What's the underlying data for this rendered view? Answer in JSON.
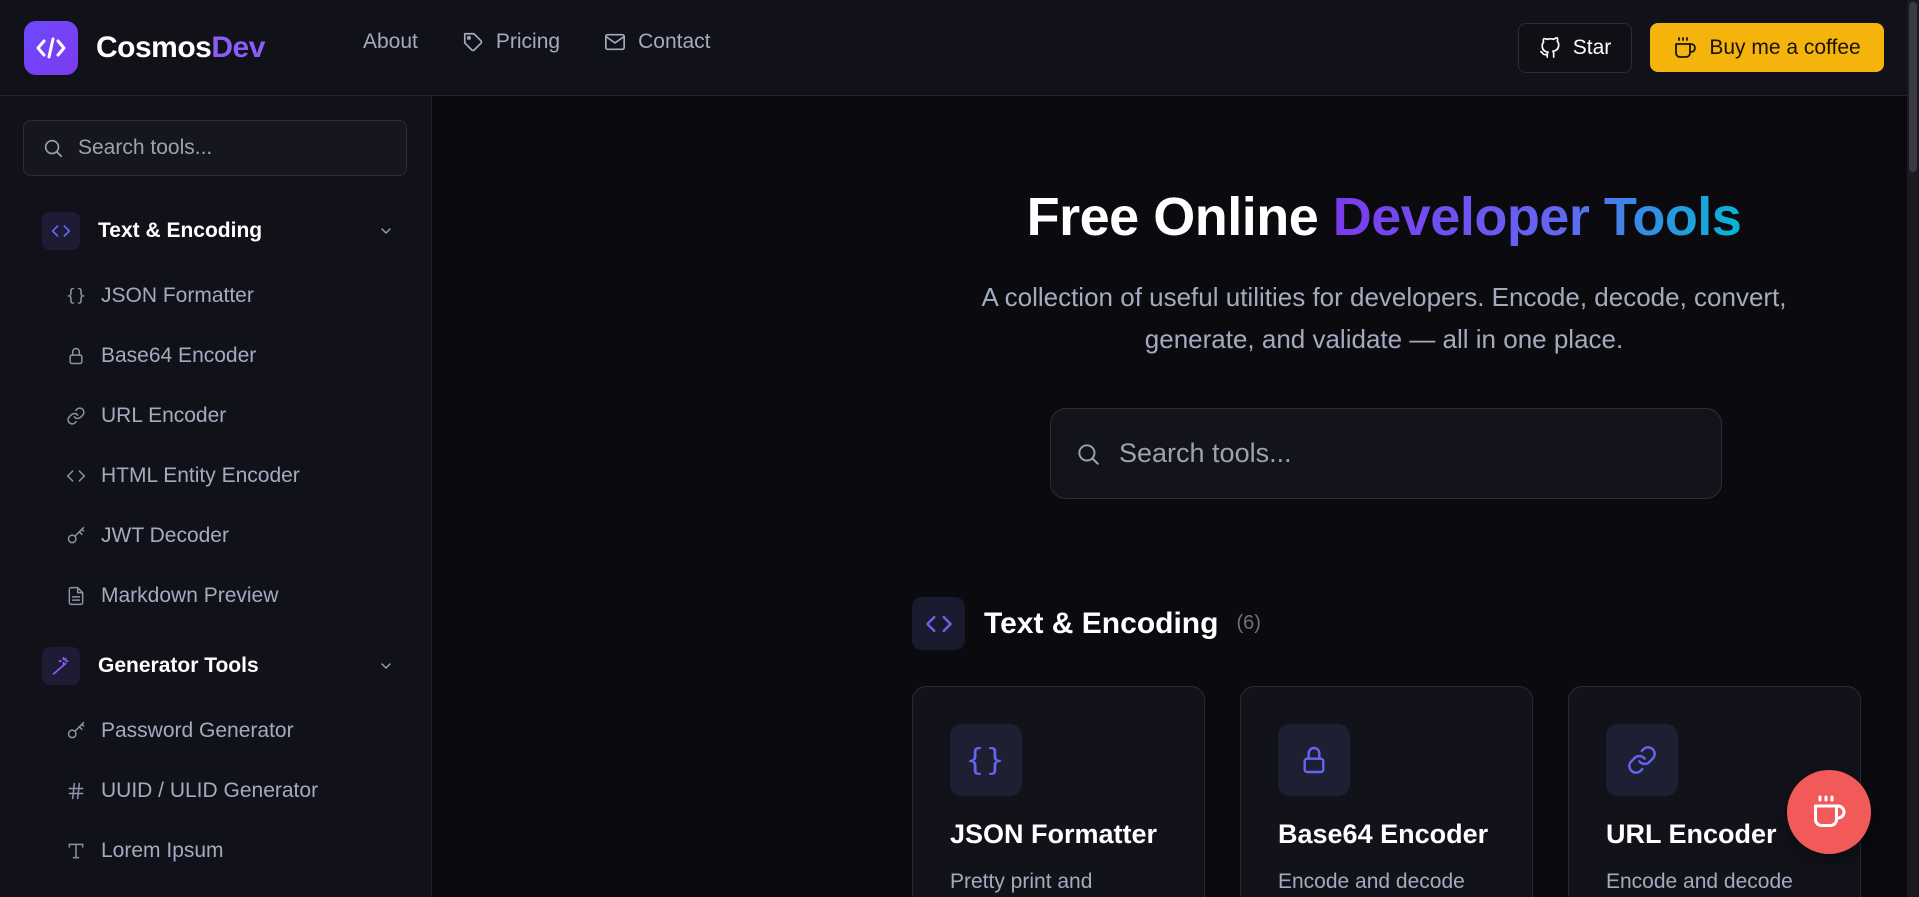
{
  "brand": {
    "name_part1": "Cosmos",
    "name_part2": "Dev",
    "accent": "#8b5cf6"
  },
  "nav": [
    {
      "label": "About",
      "icon": "none"
    },
    {
      "label": "Pricing",
      "icon": "tag-icon"
    },
    {
      "label": "Contact",
      "icon": "mail-icon"
    }
  ],
  "header_actions": {
    "star_label": "Star",
    "coffee_label": "Buy me a coffee",
    "coffee_color": "#f5b40b"
  },
  "sidebar": {
    "search_placeholder": "Search tools...",
    "groups": [
      {
        "label": "Text & Encoding",
        "icon": "code-icon",
        "items": [
          {
            "label": "JSON Formatter",
            "icon": "braces-icon"
          },
          {
            "label": "Base64 Encoder",
            "icon": "lock-icon"
          },
          {
            "label": "URL Encoder",
            "icon": "link-icon"
          },
          {
            "label": "HTML Entity Encoder",
            "icon": "code-icon"
          },
          {
            "label": "JWT Decoder",
            "icon": "key-icon"
          },
          {
            "label": "Markdown Preview",
            "icon": "file-text-icon"
          }
        ]
      },
      {
        "label": "Generator Tools",
        "icon": "wand-icon",
        "items": [
          {
            "label": "Password Generator",
            "icon": "key-icon"
          },
          {
            "label": "UUID / ULID Generator",
            "icon": "hash-icon"
          },
          {
            "label": "Lorem Ipsum",
            "icon": "type-icon"
          }
        ]
      }
    ]
  },
  "hero": {
    "title_plain": "Free Online ",
    "title_gradient": "Developer Tools",
    "subtitle_line1": "A collection of useful utilities for developers. Encode, decode, convert,",
    "subtitle_line2": "generate, and validate — all in one place.",
    "search_placeholder": "Search tools..."
  },
  "section": {
    "title": "Text & Encoding",
    "count": "(6)",
    "cards": [
      {
        "title": "JSON Formatter",
        "desc": "Pretty print and",
        "icon": "braces-icon"
      },
      {
        "title": "Base64 Encoder",
        "desc": "Encode and decode",
        "icon": "lock-icon"
      },
      {
        "title": "URL Encoder",
        "desc": "Encode and decode",
        "icon": "link-icon"
      }
    ]
  }
}
